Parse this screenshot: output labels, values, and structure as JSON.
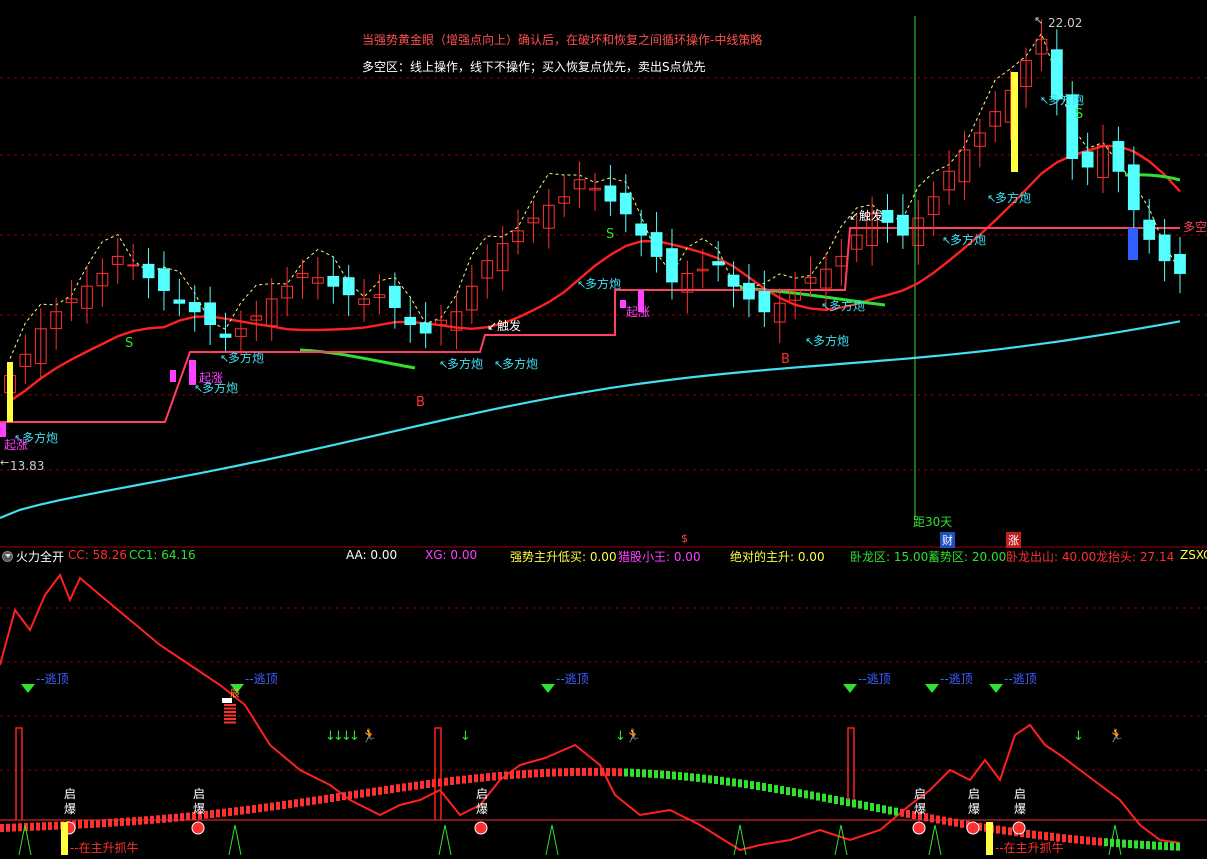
{
  "top_notes": {
    "line1": "当强势黄金眼（增强点向上）确认后，在破坏和恢复之间循环操作-中线策略",
    "line2": "多空区：线上操作，线下不操作；买入恢复点优先，卖出S点优先"
  },
  "price_labels": {
    "high": "22.02",
    "low": "13.83"
  },
  "bottom_axis_labels": {
    "dist30": "距30天",
    "s_mark": "$",
    "cai": "财",
    "zhang": "涨"
  },
  "indicator_header": {
    "name": "火力全开",
    "cc": "CC: 58.26",
    "cc1": "CC1: 64.16",
    "aa": "AA: 0.00",
    "xg": "XG: 0.00",
    "qs": "强势主升低买: 0.00",
    "lp": "猎股小王: 0.00",
    "jd": "绝对的主升: 0.00",
    "wl": "卧龙区: 15.00",
    "xs": "蓄势区: 20.00",
    "wlcs": "卧龙出山: 40.00",
    "ltt": "龙抬头: 27.14",
    "zsx": "ZSXC"
  },
  "annotations": {
    "duofangpao": "多方炮",
    "chufa": "触发",
    "duokong": "多空",
    "taotao": "逃顶",
    "qibao": "启爆",
    "zaizhu": "在主升抓牛",
    "qiqian": "起涨",
    "b": "B",
    "s": "S"
  },
  "colors": {
    "up": "#ff3030",
    "down": "#54ffff",
    "ma_red": "#ff2020",
    "ma_cyan": "#40e0f0",
    "green": "#30e030",
    "grid": "#8b0000",
    "magenta": "#ff40ff",
    "yellow": "#ffff40",
    "blue": "#3060ff"
  },
  "chart_data": {
    "type": "candlestick",
    "price_range": [
      12.0,
      22.5
    ],
    "close": [
      14.1,
      14.6,
      15.2,
      15.6,
      15.9,
      16.2,
      16.5,
      16.9,
      16.7,
      16.4,
      16.1,
      15.8,
      15.6,
      15.3,
      15.0,
      15.2,
      15.5,
      15.9,
      16.2,
      16.5,
      16.4,
      16.2,
      16.0,
      15.9,
      16.0,
      15.7,
      15.3,
      15.1,
      15.4,
      15.6,
      16.2,
      16.8,
      17.2,
      17.5,
      17.8,
      18.1,
      18.3,
      18.7,
      18.5,
      18.2,
      17.9,
      17.4,
      16.9,
      16.3,
      16.5,
      16.6,
      16.7,
      16.2,
      15.9,
      15.6,
      15.8,
      16.1,
      16.4,
      16.6,
      16.9,
      17.4,
      17.9,
      17.7,
      17.4,
      17.8,
      18.3,
      18.9,
      19.4,
      19.8,
      20.3,
      20.8,
      21.5,
      22.0,
      20.6,
      19.2,
      19.0,
      19.5,
      18.9,
      18.0,
      17.3,
      16.8,
      16.5
    ]
  }
}
